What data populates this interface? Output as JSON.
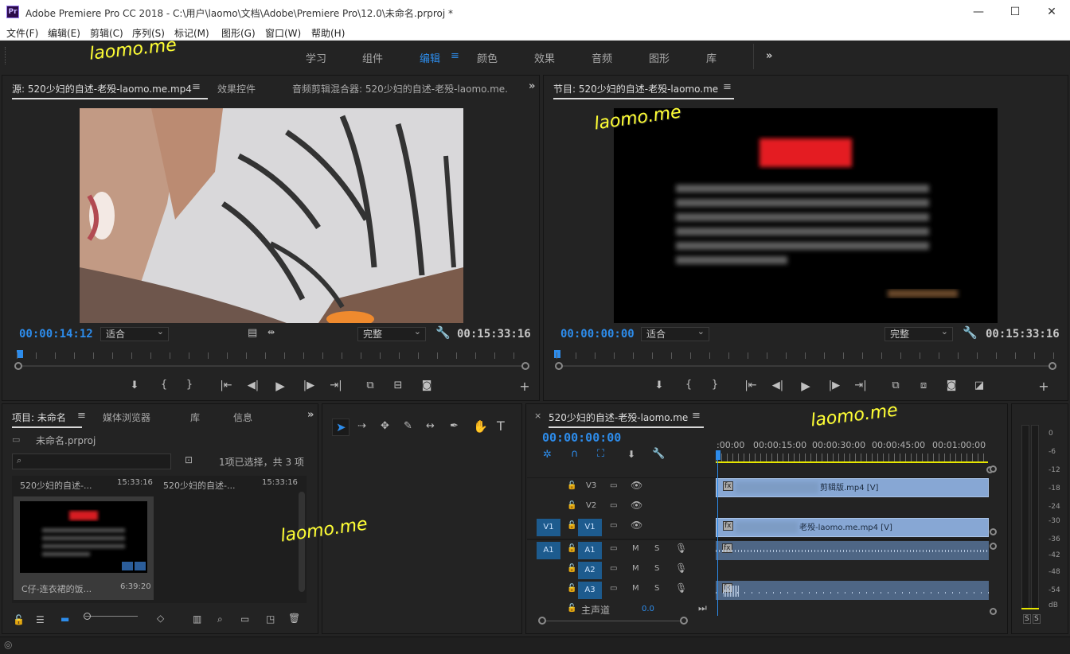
{
  "window": {
    "title": "Adobe Premiere Pro CC 2018 - C:\\用户\\laomo\\文档\\Adobe\\Premiere Pro\\12.0\\未命名.prproj *",
    "app_icon": "Pr"
  },
  "menu": [
    "文件(F)",
    "编辑(E)",
    "剪辑(C)",
    "序列(S)",
    "标记(M)",
    "图形(G)",
    "窗口(W)",
    "帮助(H)"
  ],
  "workspaces": {
    "items": [
      "学习",
      "组件",
      "编辑",
      "颜色",
      "效果",
      "音频",
      "图形",
      "库"
    ],
    "active": "编辑",
    "more": "»"
  },
  "watermark": "laomo.me",
  "source_panel": {
    "tabs": [
      "源: 520少妇的自述-老殁-laomo.me.mp4",
      "效果控件",
      "音频剪辑混合器: 520少妇的自述-老殁-laomo.me."
    ],
    "timecode": "00:00:14:12",
    "fit": "适合",
    "quality": "完整",
    "duration": "00:15:33:16"
  },
  "program_panel": {
    "tab": "节目: 520少妇的自述-老殁-laomo.me",
    "timecode": "00:00:00:00",
    "fit": "适合",
    "quality": "完整",
    "duration": "00:15:33:16"
  },
  "project_panel": {
    "tabs": [
      "项目: 未命名",
      "媒体浏览器",
      "库",
      "信息"
    ],
    "project_file": "未命名.prproj",
    "selection_status": "1项已选择，共 3 项",
    "items": [
      {
        "name": "520少妇的自述-...",
        "duration": "15:33:16"
      },
      {
        "name": "520少妇的自述-...",
        "duration": "15:33:16"
      },
      {
        "name": "C仔-连衣裙的饭...",
        "duration": "6:39:20"
      }
    ]
  },
  "timeline_panel": {
    "tab": "520少妇的自述-老殁-laomo.me",
    "timecode": "00:00:00:00",
    "ruler": [
      ":00:00",
      "00:00:15:00",
      "00:00:30:00",
      "00:00:45:00",
      "00:01:00:00"
    ],
    "video_tracks": [
      {
        "name": "V3"
      },
      {
        "name": "V2"
      },
      {
        "name": "V1",
        "source": "V1"
      }
    ],
    "audio_tracks": [
      {
        "name": "A1",
        "source": "A1",
        "m": "M",
        "s": "S"
      },
      {
        "name": "A2",
        "m": "M",
        "s": "S"
      },
      {
        "name": "A3",
        "m": "M",
        "s": "S"
      }
    ],
    "master": {
      "label": "主声道",
      "value": "0.0"
    },
    "clips": {
      "v3": "剪辑版.mp4 [V]",
      "v1": "老殁-laomo.me.mp4 [V]",
      "fx": "fx"
    }
  },
  "audio_meter": {
    "labels": [
      "0",
      "-6",
      "-12",
      "-18",
      "-24",
      "-30",
      "-36",
      "-42",
      "-48",
      "-54",
      "dB"
    ],
    "solo": [
      "S",
      "S"
    ]
  }
}
